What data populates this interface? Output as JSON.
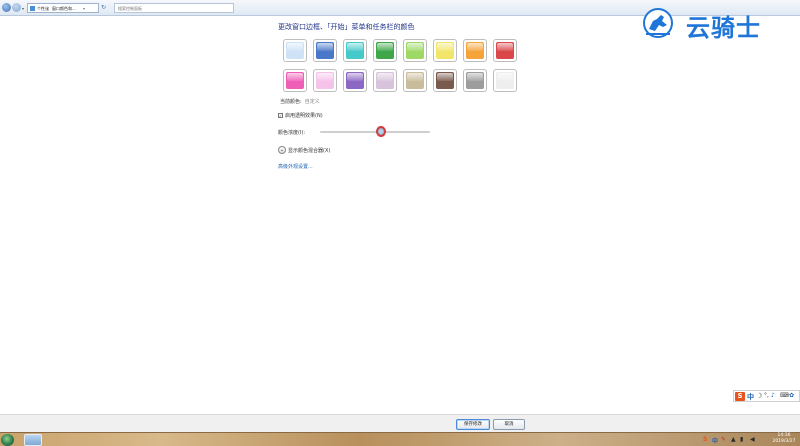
{
  "address_bar": {
    "crumbs": [
      "个性化",
      "窗口颜色和..."
    ],
    "separator": "▸",
    "dropdown": "▾",
    "refresh_symbol": "↻",
    "search_placeholder": "搜索控制面板"
  },
  "watermark": {
    "text": "云骑士",
    "color": "#1f76d8"
  },
  "content": {
    "title": "更改窗口边框、「开始」菜单和任务栏的颜色",
    "swatches": [
      {
        "name": "sky",
        "color": "#cfe3f7"
      },
      {
        "name": "twilight",
        "color": "#4a78c9"
      },
      {
        "name": "sea",
        "color": "#45c9c9"
      },
      {
        "name": "leaf",
        "color": "#3fa64a"
      },
      {
        "name": "lime",
        "color": "#9ed966"
      },
      {
        "name": "lemon",
        "color": "#f2e66a"
      },
      {
        "name": "pumpkin",
        "color": "#f5a43a"
      },
      {
        "name": "ruby",
        "color": "#d9474a"
      },
      {
        "name": "fuchsia",
        "color": "#ef5fb8"
      },
      {
        "name": "blush",
        "color": "#f5c2ea"
      },
      {
        "name": "violet",
        "color": "#8d67c4"
      },
      {
        "name": "lavender",
        "color": "#d8c3dc"
      },
      {
        "name": "taupe",
        "color": "#c9bc9a"
      },
      {
        "name": "chocolate",
        "color": "#7a5a4c"
      },
      {
        "name": "slate",
        "color": "#9d9d9d"
      },
      {
        "name": "frost",
        "color": "#eeeeee"
      }
    ],
    "current_color_label": "当前颜色:",
    "current_color_value": "自定义",
    "transparency_checkbox_label": "启用透明效果(N)",
    "transparency_checked": true,
    "intensity_label": "颜色浓度(I):",
    "intensity_level_percent": 55,
    "mixer_toggle_label": "显示颜色混合器(X)",
    "advanced_link": "高级外观设置..."
  },
  "footer": {
    "save_label": "保存修改",
    "cancel_label": "取消"
  },
  "ime_bar": {
    "logo": "S",
    "mode": "中",
    "moon": "☽",
    "dot": "°,",
    "mic": "♪",
    "keyboard": "⌨",
    "skin": "✿"
  },
  "taskbar": {
    "tray_icons": [
      "S",
      "中",
      "✎",
      "▲",
      "▮",
      "◀"
    ],
    "time": "14:36",
    "date": "2019/3/27"
  }
}
